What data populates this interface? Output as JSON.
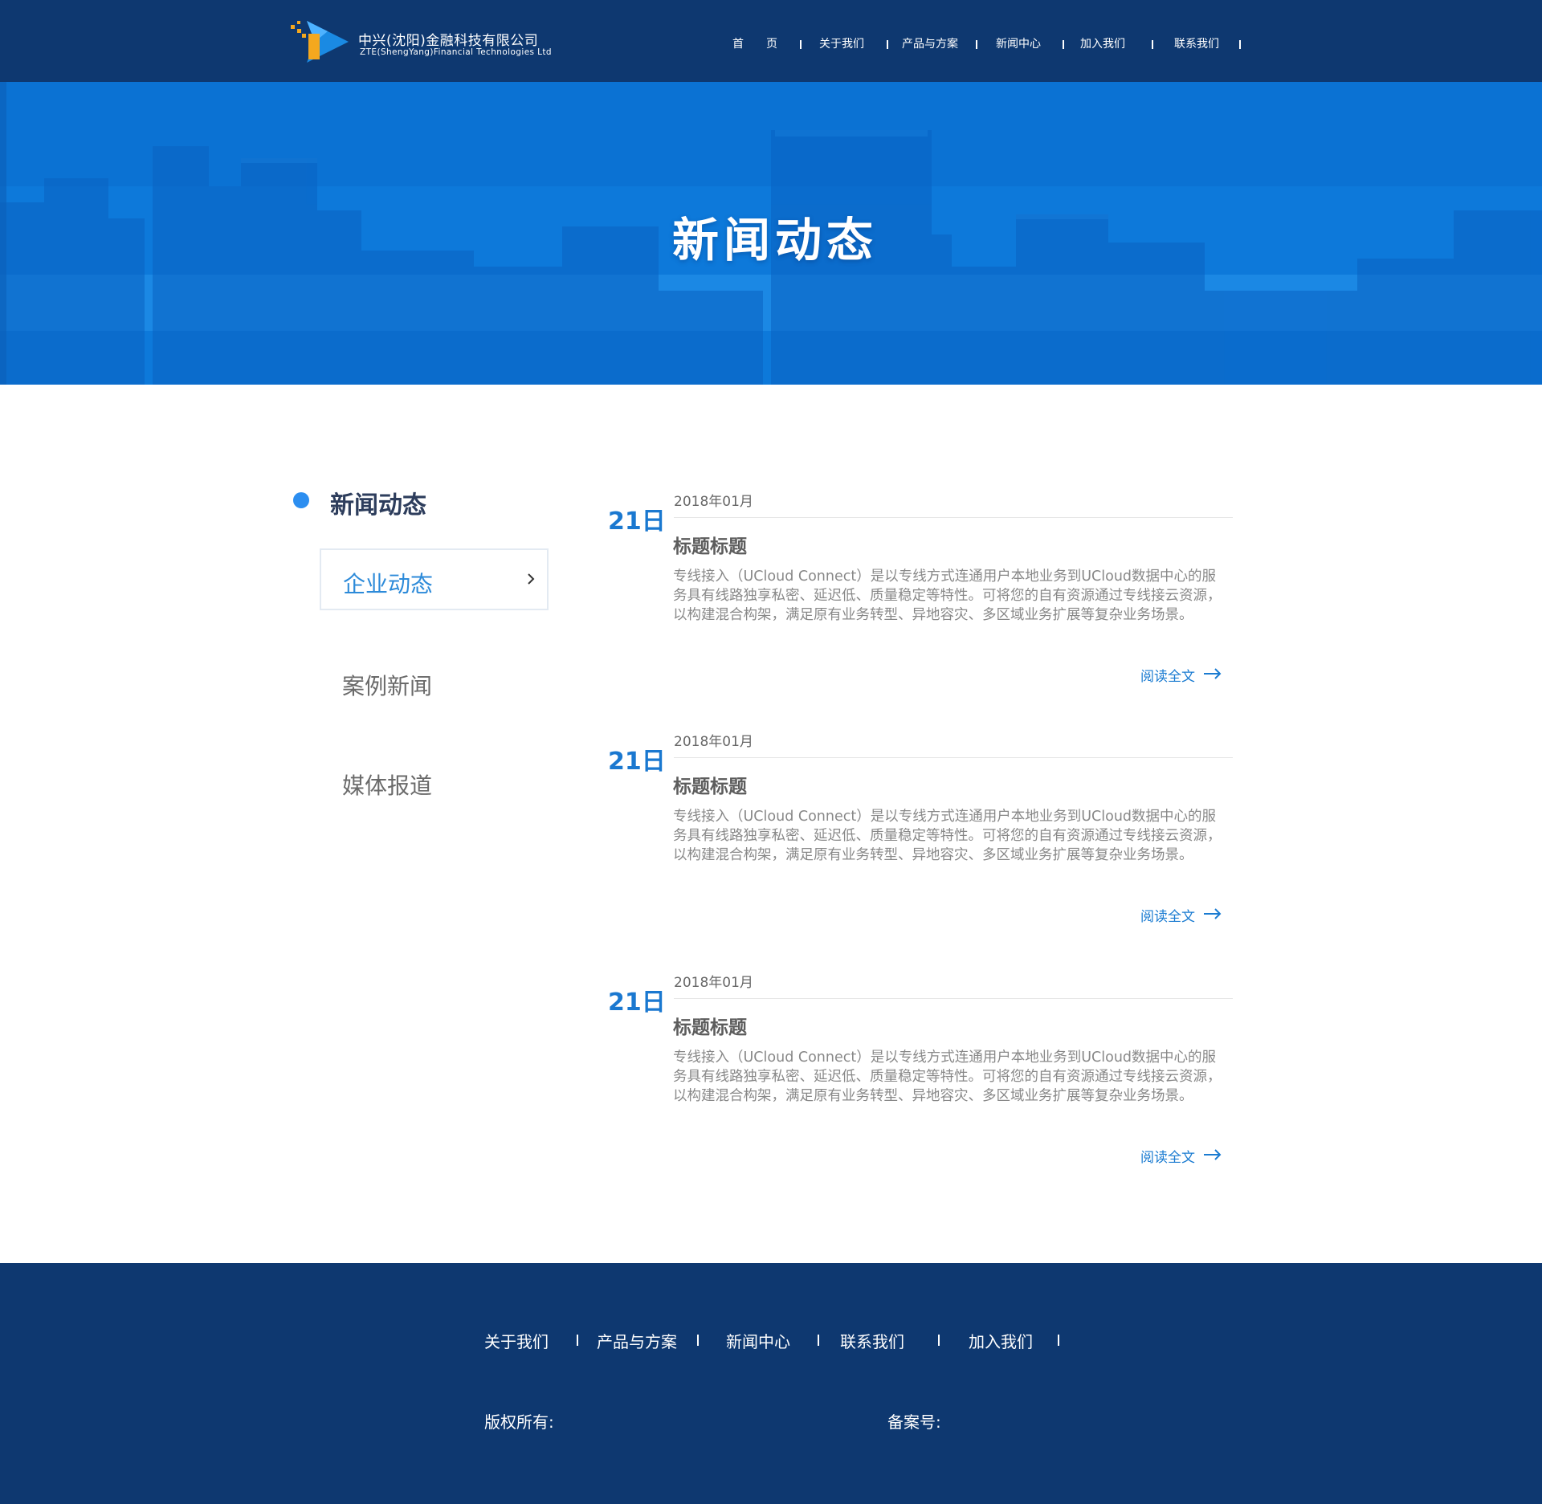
{
  "header": {
    "company_cn": "中兴(沈阳)金融科技有限公司",
    "company_en": "ZTE(ShengYang)Financial Technologies Ltd",
    "nav": [
      "首　　页",
      "关于我们",
      "产品与方案",
      "新闻中心",
      "加入我们",
      "联系我们"
    ]
  },
  "banner": {
    "title": "新闻动态"
  },
  "sidebar": {
    "heading": "新闻动态",
    "items": [
      "企业动态",
      "案例新闻",
      "媒体报道"
    ],
    "active_index": 0
  },
  "articles": [
    {
      "day": "21日",
      "date": "2018年01月",
      "title": "标题标题",
      "body": "专线接入（UCloud Connect）是以专线方式连通用户本地业务到UCloud数据中心的服务具有线路独享私密、延迟低、质量稳定等特性。可将您的自有资源通过专线接云资源，以构建混合构架，满足原有业务转型、异地容灾、多区域业务扩展等复杂业务场景。",
      "more": "阅读全文"
    },
    {
      "day": "21日",
      "date": "2018年01月",
      "title": "标题标题",
      "body": "专线接入（UCloud Connect）是以专线方式连通用户本地业务到UCloud数据中心的服务具有线路独享私密、延迟低、质量稳定等特性。可将您的自有资源通过专线接云资源，以构建混合构架，满足原有业务转型、异地容灾、多区域业务扩展等复杂业务场景。",
      "more": "阅读全文"
    },
    {
      "day": "21日",
      "date": "2018年01月",
      "title": "标题标题",
      "body": "专线接入（UCloud Connect）是以专线方式连通用户本地业务到UCloud数据中心的服务具有线路独享私密、延迟低、质量稳定等特性。可将您的自有资源通过专线接云资源，以构建混合构架，满足原有业务转型、异地容灾、多区域业务扩展等复杂业务场景。",
      "more": "阅读全文"
    }
  ],
  "footer": {
    "links": [
      "关于我们",
      "产品与方案",
      "新闻中心",
      "联系我们",
      "加入我们"
    ],
    "copyright_label": "版权所有:",
    "icp_label": "备案号:"
  },
  "colors": {
    "header_bg": "#0e3870",
    "banner_blue": "#1b8ae6",
    "accent": "#2c8ef0",
    "link": "#1a7bd1"
  }
}
